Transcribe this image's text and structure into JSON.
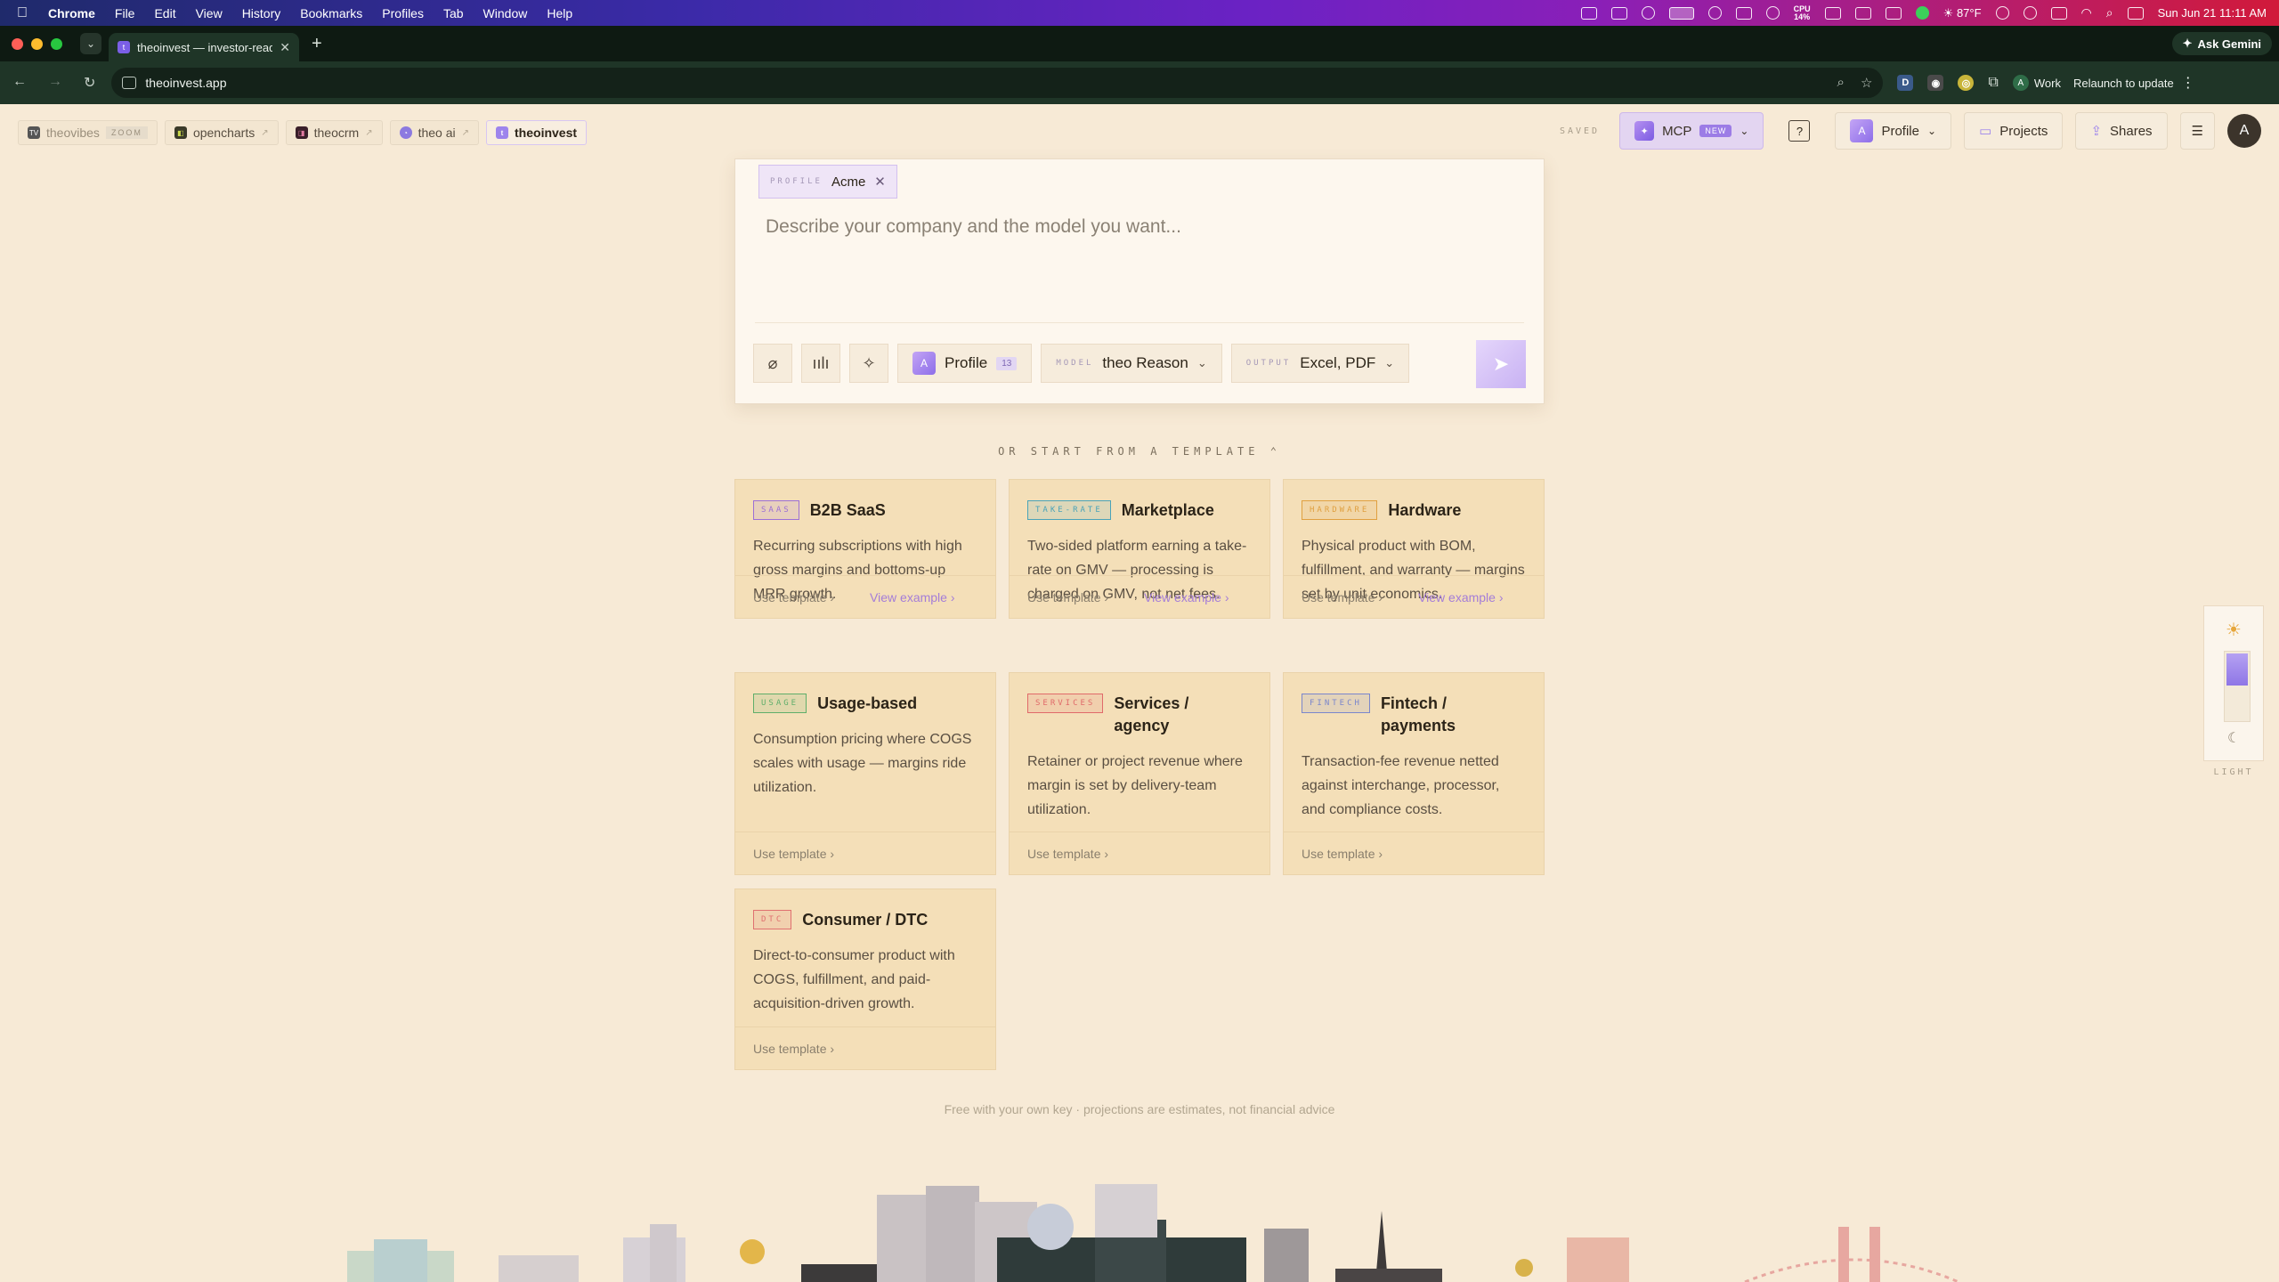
{
  "menubar": {
    "app": "Chrome",
    "menus": [
      "File",
      "Edit",
      "View",
      "History",
      "Bookmarks",
      "Profiles",
      "Tab",
      "Window",
      "Help"
    ],
    "cpu_label": "CPU",
    "cpu_value": "14%",
    "weather": "87°F",
    "datetime": "Sun Jun 21  11:11 AM"
  },
  "browser": {
    "tab_title": "theoinvest — investor-ready",
    "ask_gemini": "Ask Gemini",
    "url": "theoinvest.app",
    "profile": "Work",
    "relaunch": "Relaunch to update"
  },
  "apptabs": [
    {
      "label": "theovibes",
      "badge": "ZOOM"
    },
    {
      "label": "opencharts"
    },
    {
      "label": "theocrm"
    },
    {
      "label": "theo ai"
    },
    {
      "label": "theoinvest"
    }
  ],
  "header": {
    "saved": "SAVED",
    "mcp": "MCP",
    "mcp_badge": "NEW",
    "help": "?",
    "profile_initial": "A",
    "profile": "Profile",
    "projects": "Projects",
    "shares": "Shares",
    "user_initial": "A"
  },
  "composer": {
    "profile_label": "PROFILE",
    "profile_value": "Acme",
    "placeholder": "Describe your company and the model you want...",
    "profile_initial": "A",
    "profile_pill": "Profile",
    "profile_count": "13",
    "model_label": "MODEL",
    "model_value": "theo Reason",
    "output_label": "OUTPUT",
    "output_value": "Excel, PDF"
  },
  "templates": {
    "heading": "OR START FROM A TEMPLATE",
    "use_label": "Use template",
    "view_label": "View example",
    "cards": [
      {
        "tag": "SAAS",
        "title": "B2B SaaS",
        "desc": "Recurring subscriptions with high gross margins and bottoms-up MRR growth.",
        "tag_color": "#9c6fd6"
      },
      {
        "tag": "TAKE-RATE",
        "title": "Marketplace",
        "desc": "Two-sided platform earning a take-rate on GMV — processing is charged on GMV, not net fees.",
        "tag_color": "#4aa3b8"
      },
      {
        "tag": "HARDWARE",
        "title": "Hardware",
        "desc": "Physical product with BOM, fulfillment, and warranty — margins set by unit economics.",
        "tag_color": "#e0a040"
      },
      {
        "tag": "USAGE",
        "title": "Usage-based",
        "desc": "Consumption pricing where COGS scales with usage — margins ride utilization.",
        "tag_color": "#5fae6a"
      },
      {
        "tag": "SERVICES",
        "title": "Services / agency",
        "desc": "Retainer or project revenue where margin is set by delivery-team utilization.",
        "tag_color": "#e06a6a"
      },
      {
        "tag": "FINTECH",
        "title": "Fintech / payments",
        "desc": "Transaction-fee revenue netted against interchange, processor, and compliance costs.",
        "tag_color": "#7a86cc"
      },
      {
        "tag": "DTC",
        "title": "Consumer / DTC",
        "desc": "Direct-to-consumer product with COGS, fulfillment, and paid-acquisition-driven growth.",
        "tag_color": "#e07070"
      }
    ]
  },
  "disclaimer": "Free with your own key · projections are estimates, not financial advice",
  "theme": {
    "label": "LIGHT"
  }
}
